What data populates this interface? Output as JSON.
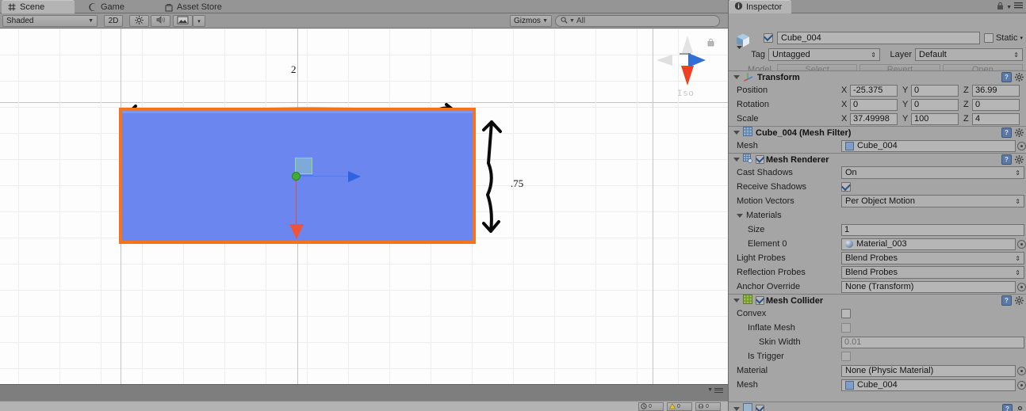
{
  "scene": {
    "tabs": [
      {
        "label": "Scene",
        "icon": "scene-grid-icon",
        "active": true
      },
      {
        "label": "Game",
        "icon": "game-pad-icon",
        "active": false
      },
      {
        "label": "Asset Store",
        "icon": "store-bag-icon",
        "active": false
      }
    ],
    "toolbar": {
      "shading_mode": "Shaded",
      "mode_2d": "2D",
      "lighting_icon": "sun-icon",
      "audio_icon": "speaker-icon",
      "effects_icon": "image-icon",
      "effects_arrow": "▾",
      "gizmos_label": "Gizmos",
      "gizmos_arrow": "▾",
      "search_placeholder": "All",
      "search_value": "All",
      "search_icon": "search-icon"
    },
    "view_gizmo": {
      "label": "Iso",
      "lock_icon": "lock-icon",
      "axis_up_color": "#e3e3e3",
      "axis_right_color": "#2f6fd6",
      "axis_down_color": "#ef3f22"
    },
    "annotations": [
      {
        "text": "2",
        "kind": "measure-label-width"
      },
      {
        "text": ".75",
        "kind": "measure-label-height"
      }
    ],
    "selection": {
      "fill_color": "#6b86ee",
      "outline_color": "#f4741e"
    },
    "console": {
      "clear_label": "",
      "warn_icon": "warning-icon",
      "error_icon": "error-icon"
    }
  },
  "inspector": {
    "tab_label": "Inspector",
    "tab_icon": "info-icon",
    "lock_icon": "lock-icon",
    "menu_icon": "hamburger-icon",
    "object": {
      "icon": "cube-prefab-icon",
      "enabled": true,
      "name": "Cube_004",
      "static_label": "Static",
      "static_checked": false,
      "static_arrow": "▾",
      "tag_label": "Tag",
      "tag_value": "Untagged",
      "layer_label": "Layer",
      "layer_value": "Default",
      "model_label": "Model",
      "model_buttons": [
        "Select",
        "Revert",
        "Open"
      ]
    },
    "components": [
      {
        "id": "transform",
        "title": "Transform",
        "icon": "transform-axis-icon",
        "has_checkbox": false,
        "rows": [
          {
            "label": "Position",
            "type": "vec3",
            "x": "-25.375",
            "y": "0",
            "z": "36.99"
          },
          {
            "label": "Rotation",
            "type": "vec3",
            "x": "0",
            "y": "0",
            "z": "0"
          },
          {
            "label": "Scale",
            "type": "vec3",
            "x": "37.49998",
            "y": "100",
            "z": "4"
          }
        ]
      },
      {
        "id": "mesh-filter",
        "title": "Cube_004 (Mesh Filter)",
        "icon": "mesh-filter-icon",
        "has_checkbox": false,
        "rows": [
          {
            "label": "Mesh",
            "type": "object",
            "value": "Cube_004",
            "value_icon": "mesh-icon"
          }
        ]
      },
      {
        "id": "mesh-renderer",
        "title": "Mesh Renderer",
        "icon": "mesh-renderer-icon",
        "has_checkbox": true,
        "checked": true,
        "rows": [
          {
            "label": "Cast Shadows",
            "type": "popup",
            "value": "On"
          },
          {
            "label": "Receive Shadows",
            "type": "checkbox",
            "checked": true
          },
          {
            "label": "Motion Vectors",
            "type": "popup",
            "value": "Per Object Motion"
          },
          {
            "label": "Materials",
            "type": "foldout"
          },
          {
            "label": "Size",
            "type": "text",
            "value": "1",
            "indent": 1
          },
          {
            "label": "Element 0",
            "type": "object",
            "value": "Material_003",
            "value_icon": "material-ball-icon",
            "indent": 1
          },
          {
            "label": "Light Probes",
            "type": "popup",
            "value": "Blend Probes"
          },
          {
            "label": "Reflection Probes",
            "type": "popup",
            "value": "Blend Probes"
          },
          {
            "label": "Anchor Override",
            "type": "object",
            "value": "None (Transform)"
          }
        ]
      },
      {
        "id": "mesh-collider",
        "title": "Mesh Collider",
        "icon": "mesh-collider-icon",
        "has_checkbox": true,
        "checked": true,
        "rows": [
          {
            "label": "Convex",
            "type": "checkbox",
            "checked": false
          },
          {
            "label": "Inflate Mesh",
            "type": "checkbox",
            "checked": false,
            "dim": true,
            "indent": 1
          },
          {
            "label": "Skin Width",
            "type": "text",
            "value": "0.01",
            "dim": true,
            "indent": 2
          },
          {
            "label": "Is Trigger",
            "type": "checkbox",
            "checked": false,
            "dim": true,
            "indent": 1
          },
          {
            "label": "Material",
            "type": "object",
            "value": "None (Physic Material)"
          },
          {
            "label": "Mesh",
            "type": "object",
            "value": "Cube_004",
            "value_icon": "mesh-icon"
          }
        ]
      }
    ]
  }
}
